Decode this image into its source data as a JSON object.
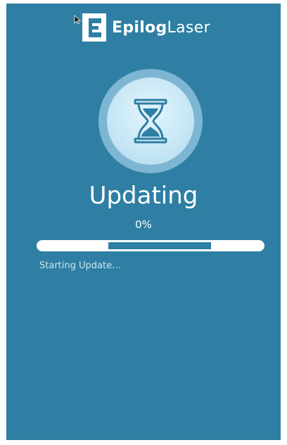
{
  "colors": {
    "background": "#2e7fa3",
    "ring": "#7db6d3",
    "disc": "#c6e6f5",
    "icon": "#2e7fa3",
    "text": "#ffffff",
    "track": "#ffffff"
  },
  "brand": {
    "logo_icon": "epilog-e-logo-icon",
    "name_bold": "Epilog",
    "name_light": "Laser"
  },
  "status_icon": "hourglass-icon",
  "update": {
    "title": "Updating",
    "percent_label": "0%",
    "status_message": "Starting Update..."
  }
}
